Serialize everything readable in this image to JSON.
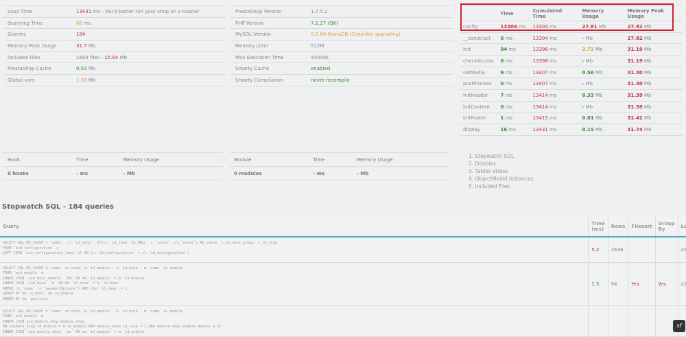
{
  "summary": [
    {
      "label": "Load Time",
      "value": "13431",
      "value_color": "red",
      "suffix": " ms - You'd better run your shop on a toaster"
    },
    {
      "label": "Querying Time",
      "value": "66",
      "value_color": "org",
      "suffix": " ms"
    },
    {
      "label": "Queries",
      "value": "184",
      "value_color": "red",
      "suffix": ""
    },
    {
      "label": "Memory Peak Usage",
      "value": "31.7",
      "value_color": "red",
      "suffix": " Mb"
    },
    {
      "label": "Included Files",
      "prefix": "1608 files - ",
      "value": "15.64",
      "value_color": "red",
      "suffix": " Mb"
    },
    {
      "label": "PrestaShop Cache",
      "value": "0.03",
      "value_color": "grn",
      "suffix": " Mb"
    },
    {
      "label": "Global vars",
      "value": "1.38",
      "value_color": "org",
      "suffix": " Mb"
    }
  ],
  "environment": [
    {
      "label": "PrestaShop Version",
      "value": "1.7.5.2",
      "color": ""
    },
    {
      "label": "PHP Version",
      "value": "7.2.27 (OK)",
      "color": "grn"
    },
    {
      "label": "MySQL Version",
      "value": "5.5.64-MariaDB (Consider upgrading)",
      "color": "org"
    },
    {
      "label": "Memory Limit",
      "value": "512M",
      "color": ""
    },
    {
      "label": "Max Execution Time",
      "value": "44000s",
      "color": ""
    },
    {
      "label": "Smarty Cache",
      "value": "enabled",
      "color": "grn"
    },
    {
      "label": "Smarty Compilation",
      "value": "never recompile",
      "color": "grn"
    }
  ],
  "steps": {
    "headers": [
      "",
      "Time",
      "Cumulated Time",
      "Memory Usage",
      "Memory Peak Usage"
    ],
    "rows": [
      [
        "config",
        "13304",
        "red",
        "13304",
        "27.81",
        "red",
        "27.82"
      ],
      [
        "__construct",
        "0",
        "grn",
        "13304",
        "-",
        "",
        "27.82"
      ],
      [
        "init",
        "94",
        "grn",
        "13398",
        "2.72",
        "org",
        "31.19"
      ],
      [
        "checkAccess",
        "0",
        "grn",
        "13398",
        "-",
        "",
        "31.19"
      ],
      [
        "setMedia",
        "9",
        "grn",
        "13407",
        "0.56",
        "grn",
        "31.30"
      ],
      [
        "postProcess",
        "0",
        "grn",
        "13407",
        "-",
        "",
        "31.30"
      ],
      [
        "initHeader",
        "7",
        "grn",
        "13414",
        "0.33",
        "grn",
        "31.39"
      ],
      [
        "initContent",
        "0",
        "grn",
        "13414",
        "-",
        "",
        "31.39"
      ],
      [
        "initFooter",
        "1",
        "grn",
        "13415",
        "0.01",
        "grn",
        "31.42"
      ],
      [
        "display",
        "16",
        "grn",
        "13431",
        "0.15",
        "grn",
        "31.74"
      ]
    ]
  },
  "hooks": {
    "headers": [
      "Hook",
      "Time",
      "Memory Usage"
    ],
    "row": [
      "0 hooks",
      "- ms",
      "- Mb"
    ]
  },
  "modules": {
    "headers": [
      "Module",
      "Time",
      "Memory Usage"
    ],
    "row": [
      "0 modules",
      "- ms",
      "- Mb"
    ]
  },
  "nav_list": [
    "1. Stopwatch SQL",
    "2. Doubles",
    "3. Tables stress",
    "4. ObjectModel instances",
    "5. Included Files"
  ],
  "sql_title": "Stopwatch SQL - 184 queries",
  "sql": {
    "headers": [
      "Query",
      "Time (ms)",
      "Rows",
      "Filesort",
      "Group By",
      "Lo"
    ],
    "rows": [
      {
        "query": "SELECT SQL_NO_CACHE c.`name`, cl.`id_lang`, IF(cl.`id_lang` IS NULL, c.`value`, cl.`value`) AS value, c.id_shop_group, c.id_shop\nFROM `acd_configuration` c\nLEFT JOIN `acd_configuration_lang` cl ON (c.`id_configuration` = cl.`id_configuration`)",
        "time": "5.2",
        "time_color": "red",
        "rows": "2636",
        "filesort": "",
        "groupby": "",
        "loc": "/cla"
      },
      {
        "query": "SELECT SQL_NO_CACHE h.`name` as hook, m.`id_module`, h.`id_hook`, m.`name` as module\nFROM `acd_module` m\nINNER JOIN `acd_hook_module` `hm` ON hm.`id_module` = m.`id_module`\nINNER JOIN `acd_hook` `h` ON hm.`id_hook` = h.`id_hook`\nWHERE (h.`name` != \"paymentOptions\") AND (hm.`id_shop` = 1)\nGROUP BY hm.id_hook, hm.id_module\nORDER BY hm.`position`",
        "time": "1.5",
        "time_color": "grn",
        "rows": "94",
        "filesort": "Yes",
        "groupby": "Yes",
        "loc": "/cla"
      },
      {
        "query": "SELECT SQL_NO_CACHE h.`name` as hook, m.`id_module`, h.`id_hook`, m.`name` as module\nFROM `acd_module` m\nINNER JOIN acd_module_shop module_shop\nON (module_shop.id_module = m.id_module AND module_shop.id_shop = 1 AND module_shop.enable_device & 1)\nINNER JOIN `acd_module_shop` `ms` ON ms.`id_module` = m.`id_module`",
        "time": "",
        "time_color": "",
        "rows": "",
        "filesort": "",
        "groupby": "",
        "loc": ""
      }
    ]
  },
  "units": {
    "ms": " ms",
    "mb": " Mb"
  },
  "symfony_badge": "sf"
}
